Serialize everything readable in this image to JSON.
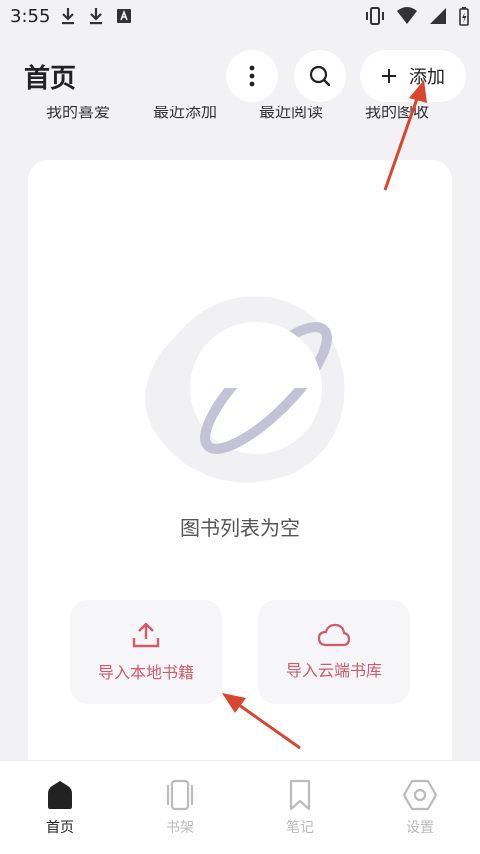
{
  "status_bar": {
    "time": "3:55"
  },
  "header": {
    "title": "首页",
    "add_label": "添加"
  },
  "filter_tabs": [
    "我的喜爱",
    "最近添加",
    "最近阅读",
    "我的图收"
  ],
  "empty_state": {
    "message": "图书列表为空"
  },
  "import_buttons": {
    "local": "导入本地书籍",
    "cloud": "导入云端书库"
  },
  "bottom_nav": [
    {
      "label": "首页",
      "icon": "home-icon",
      "active": true
    },
    {
      "label": "书架",
      "icon": "bookshelf-icon",
      "active": false
    },
    {
      "label": "笔记",
      "icon": "bookmark-icon",
      "active": false
    },
    {
      "label": "设置",
      "icon": "settings-hexagon-icon",
      "active": false
    }
  ],
  "colors": {
    "accent": "#d15a6c",
    "annotation_arrow": "#d94630",
    "background": "#f2f2f5"
  }
}
